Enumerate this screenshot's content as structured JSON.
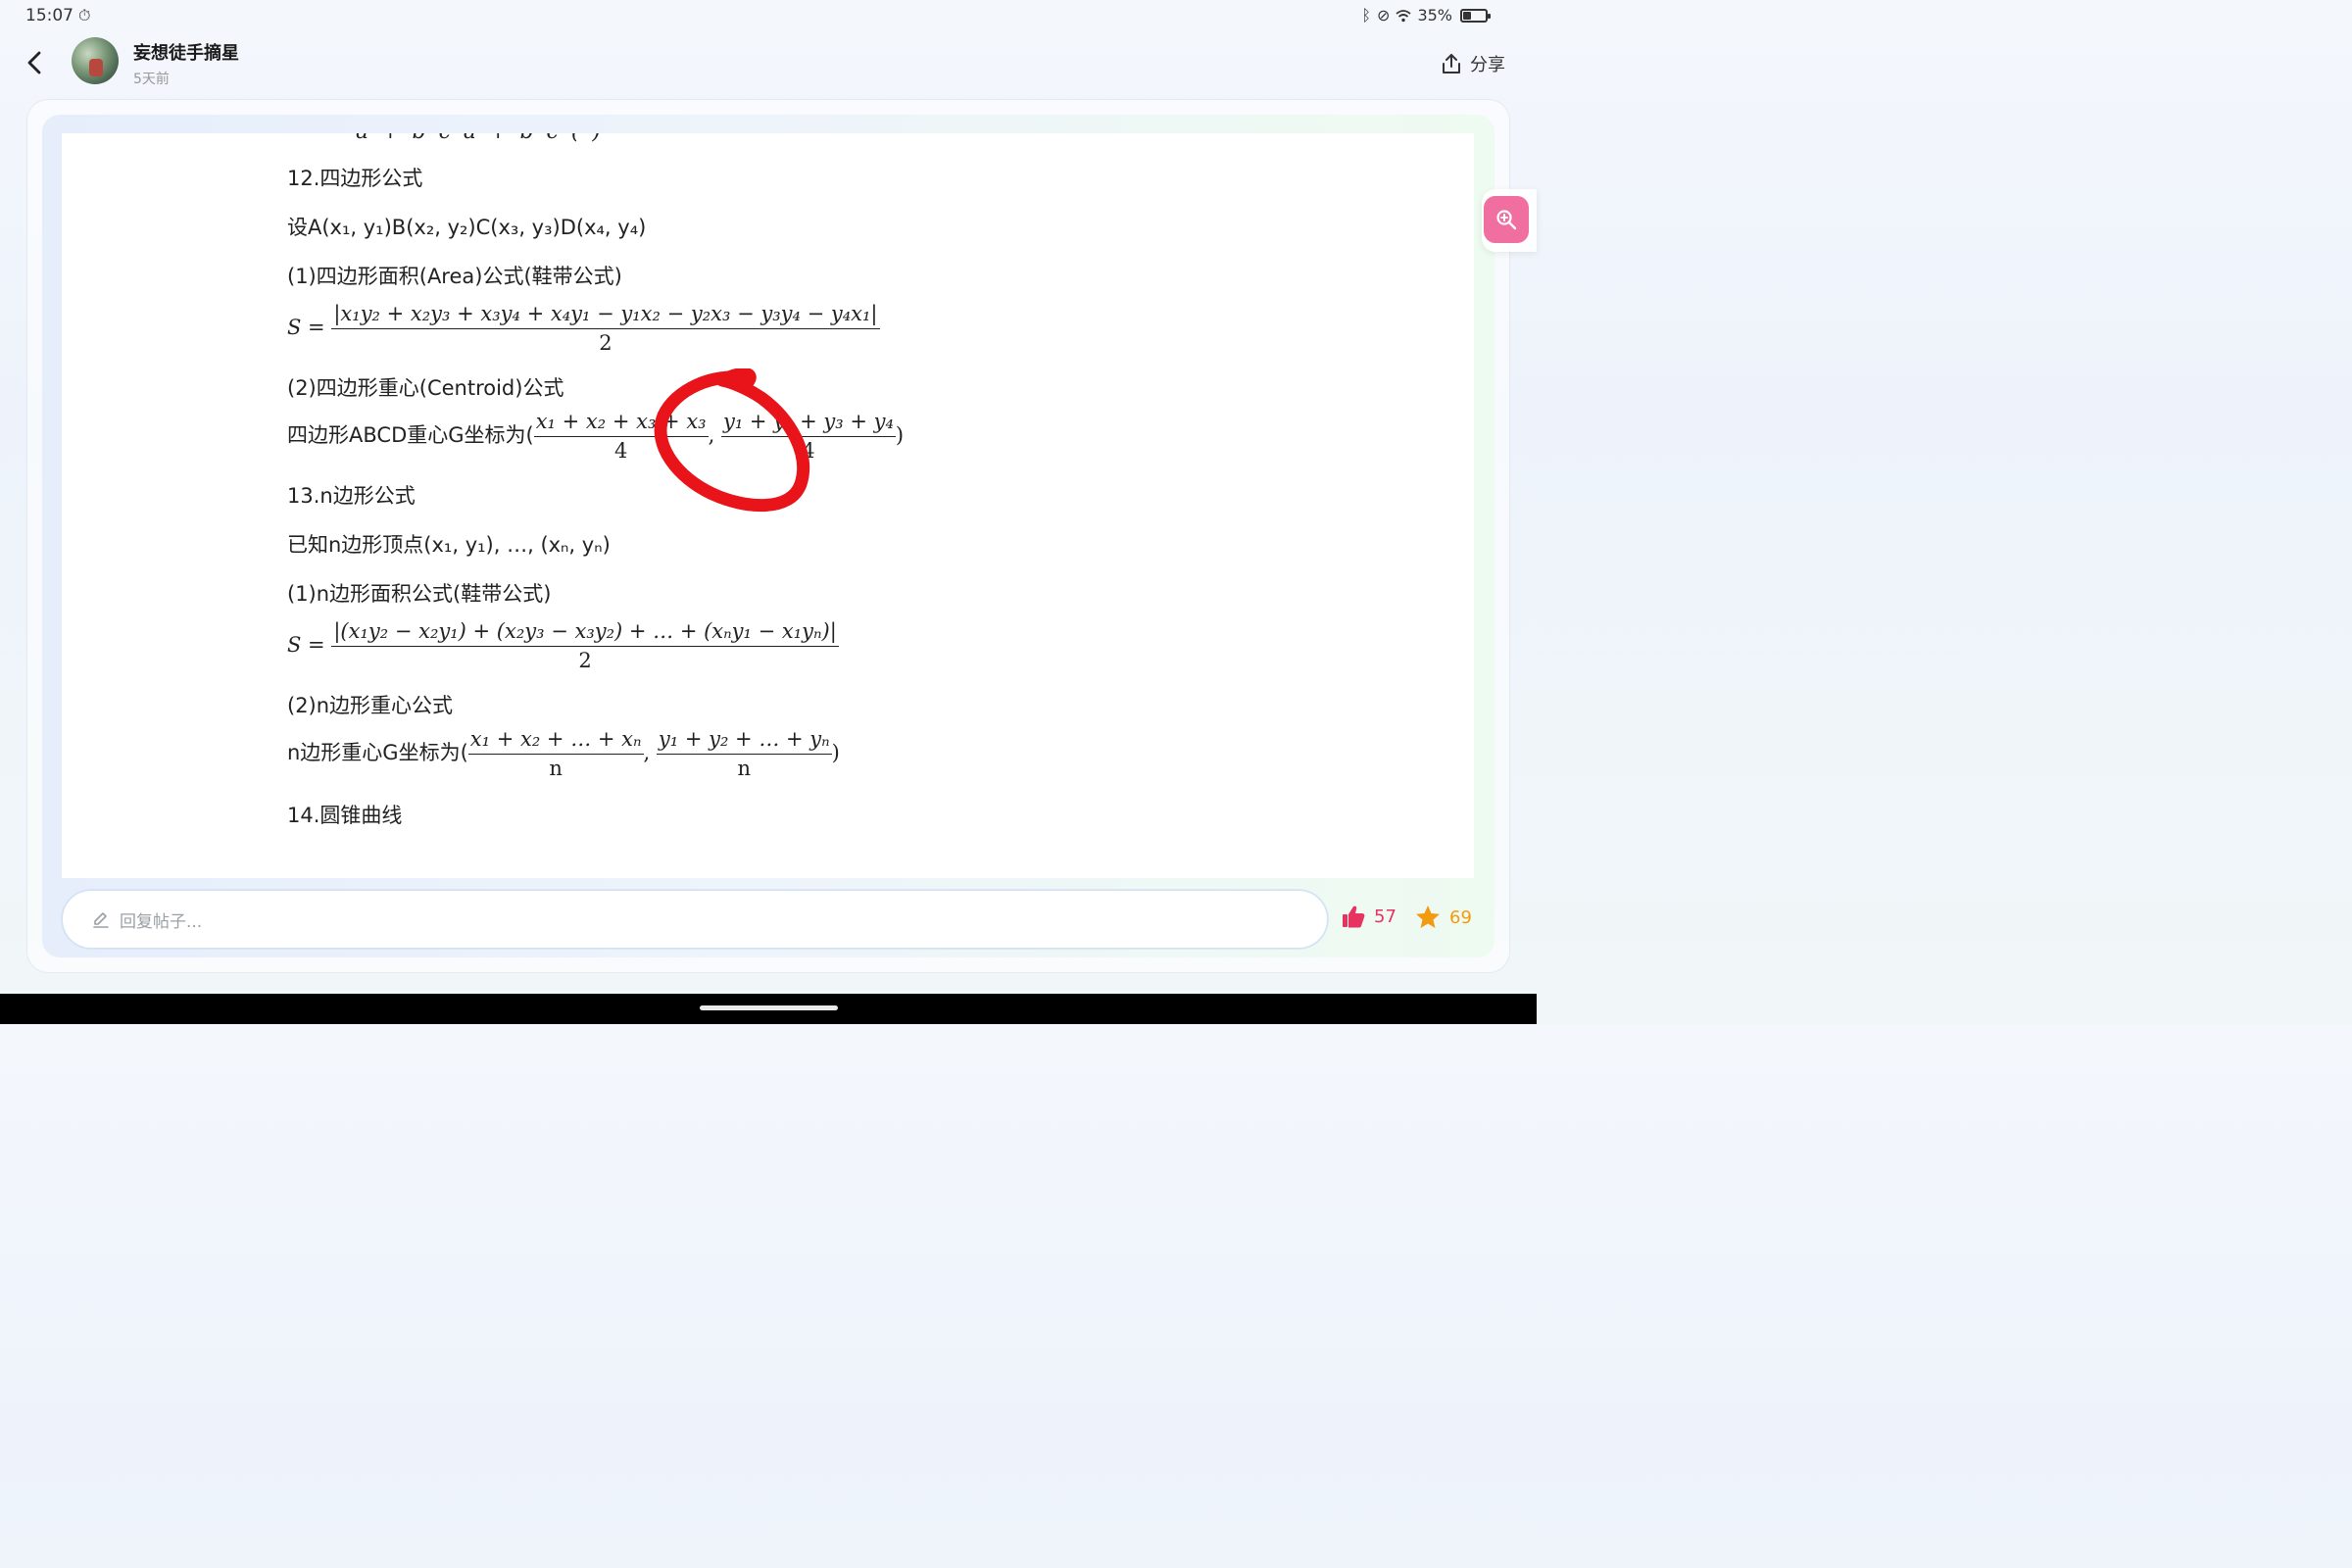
{
  "status_bar": {
    "time": "15:07",
    "battery": "35%"
  },
  "header": {
    "username": "妄想徒手摘星",
    "post_time": "5天前",
    "share_label": "分享"
  },
  "content": {
    "s12_title": "12.四边形公式",
    "s12_vertices": "设A(x₁, y₁)B(x₂, y₂)C(x₃, y₃)D(x₄, y₄)",
    "s12_area_label": "(1)四边形面积(Area)公式(鞋带公式)",
    "s12_area_lhs": "S =",
    "s12_area_num": "|x₁y₂ + x₂y₃ + x₃y₄ + x₄y₁ − y₁x₂ − y₂x₃ − y₃y₄ − y₄x₁|",
    "s12_area_den": "2",
    "s12_centroid_label": "(2)四边形重心(Centroid)公式",
    "s12_centroid_prefix": "四边形ABCD重心G坐标为(",
    "s12_cx_num": "x₁ + x₂ + x₃ + x₃",
    "s12_cx_den": "4",
    "s12_cy_num": "y₁ + y₂ + y₃ + y₄",
    "s12_cy_den": "4",
    "s13_title": "13.n边形公式",
    "s13_vertices": "已知n边形顶点(x₁, y₁), …, (xₙ, yₙ)",
    "s13_area_label": "(1)n边形面积公式(鞋带公式)",
    "s13_area_lhs": "S =",
    "s13_area_num": "|(x₁y₂ − x₂y₁) + (x₂y₃ − x₃y₂) + … + (xₙy₁ − x₁yₙ)|",
    "s13_area_den": "2",
    "s13_centroid_label": "(2)n边形重心公式",
    "s13_centroid_prefix": "n边形重心G坐标为(",
    "s13_cx_num": "x₁ + x₂ + … + xₙ",
    "s13_cx_den": "n",
    "s13_cy_num": "y₁ + y₂ + … + yₙ",
    "s13_cy_den": "n",
    "s14_title": "14.圆锥曲线"
  },
  "footer": {
    "reply_placeholder": "回复帖子...",
    "like_count": "57",
    "fav_count": "69"
  },
  "colors": {
    "annotation": "#e8141a",
    "zoom_fab": "#f06ea0",
    "like": "#e6335f",
    "favorite": "#f29a10"
  }
}
